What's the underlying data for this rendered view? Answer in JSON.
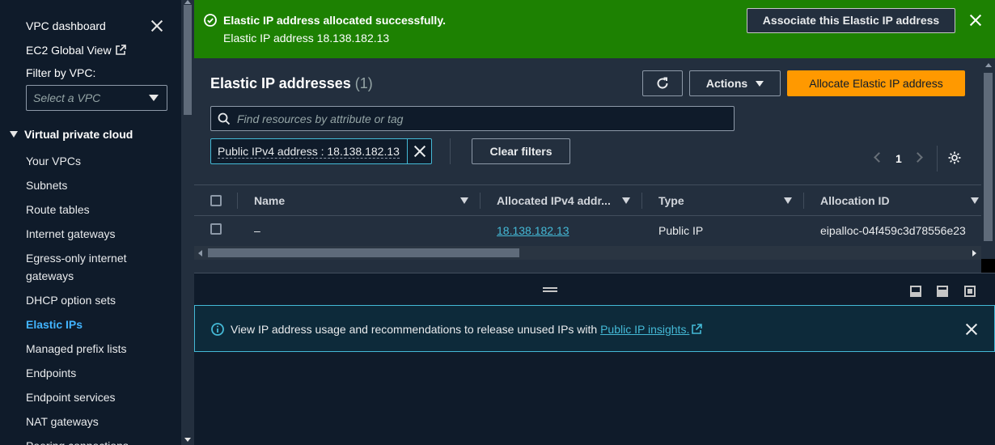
{
  "sidebar": {
    "vpc_dashboard": "VPC dashboard",
    "ec2_global_view": "EC2 Global View",
    "filter_label": "Filter by VPC:",
    "filter_placeholder": "Select a VPC",
    "section_title": "Virtual private cloud",
    "items": [
      {
        "label": "Your VPCs"
      },
      {
        "label": "Subnets"
      },
      {
        "label": "Route tables"
      },
      {
        "label": "Internet gateways"
      },
      {
        "label": "Egress-only internet"
      },
      {
        "label": "gateways"
      },
      {
        "label": "DHCP option sets"
      },
      {
        "label": "Elastic IPs",
        "active": true
      },
      {
        "label": "Managed prefix lists"
      },
      {
        "label": "Endpoints"
      },
      {
        "label": "Endpoint services"
      },
      {
        "label": "NAT gateways"
      },
      {
        "label": "Peering connections"
      }
    ]
  },
  "flash": {
    "title": "Elastic IP address allocated successfully.",
    "message": "Elastic IP address 18.138.182.13",
    "action_label": "Associate this Elastic IP address",
    "color": "#1d8102"
  },
  "header": {
    "title": "Elastic IP addresses",
    "count": "(1)",
    "actions_label": "Actions",
    "allocate_label": "Allocate Elastic IP address",
    "accent": "#ff9900"
  },
  "search": {
    "placeholder": "Find resources by attribute or tag"
  },
  "filter_token": {
    "label": "Public IPv4 address : 18.138.182.13",
    "clear_label": "Clear filters"
  },
  "pagination": {
    "current_page": "1"
  },
  "table": {
    "columns": [
      "Name",
      "Allocated IPv4 addr...",
      "Type",
      "Allocation ID"
    ],
    "rows": [
      {
        "name": "–",
        "ip": "18.138.182.13",
        "type": "Public IP",
        "allocation_id": "eipalloc-04f459c3d78556e23"
      }
    ]
  },
  "info_banner": {
    "text": "View IP address usage and recommendations to release unused IPs with",
    "link": "Public IP insights."
  }
}
